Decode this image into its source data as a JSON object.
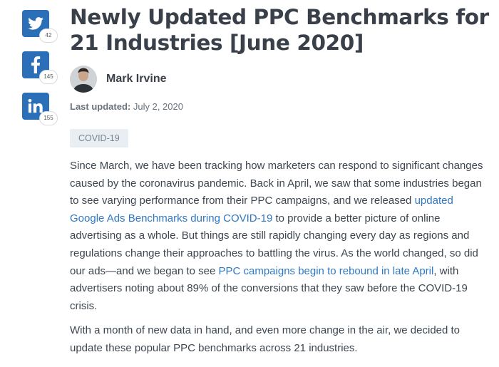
{
  "share": {
    "twitter": {
      "icon": "twitter-icon",
      "count": "42"
    },
    "facebook": {
      "icon": "facebook-icon",
      "count": "145"
    },
    "linkedin": {
      "icon": "linkedin-icon",
      "count": "155"
    },
    "color": "#2a6fb7"
  },
  "article": {
    "title": "Newly Updated PPC Benchmarks for 21 Industries [June 2020]",
    "author": "Mark Irvine",
    "updated_label": "Last updated:",
    "updated_date": "July 2, 2020",
    "tag": "COVID-19",
    "p1": {
      "t1": "Since March, we have been tracking how marketers can respond to significant changes caused by the coronavirus pandemic. Back in April, we saw that some industries began to see varying performance from their PPC campaigns, and we released ",
      "link1": "updated Google Ads Benchmarks during COVID-19",
      "t2": " to provide a better picture of online advertising as a whole. But things are still rapidly changing every day as regions and regulations change their approaches to battling the virus. As the world changed, so did our ads—and we began to see ",
      "link2": "PPC campaigns begin to rebound in late April",
      "t3": ", with advertisers noting about 89% of the conversions that they saw before the COVID-19 crisis."
    },
    "p2": "With a month of new data in hand, and even more change in the air, we decided to update these popular PPC benchmarks across 21 industries."
  },
  "colors": {
    "link": "#2f78c4",
    "title": "#3a4049",
    "body_text": "#3d4650"
  }
}
